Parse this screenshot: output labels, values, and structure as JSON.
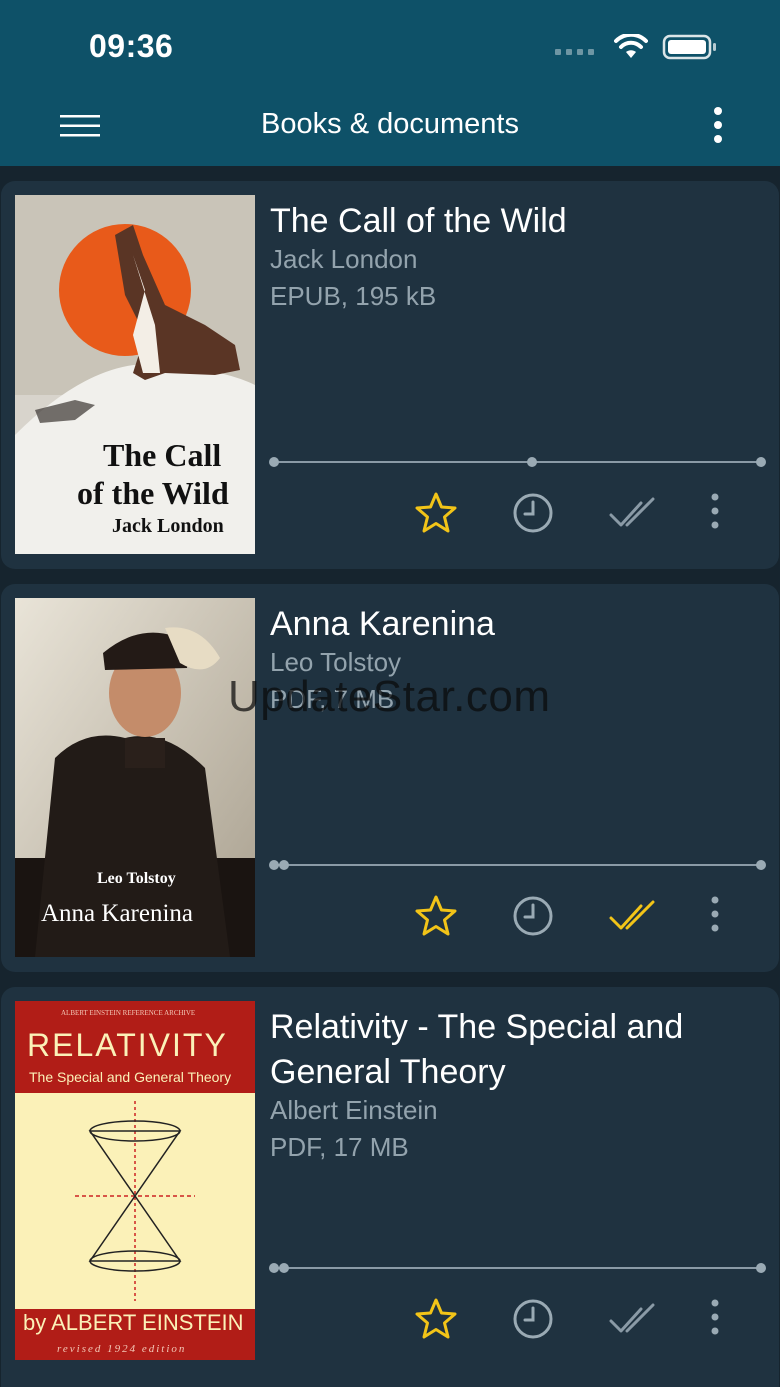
{
  "status": {
    "time": "09:36"
  },
  "header": {
    "title": "Books & documents"
  },
  "books": [
    {
      "title": "The Call of the Wild",
      "author": "Jack London",
      "format": "EPUB, 195 kB",
      "progress": 0.53,
      "favorite": true,
      "finished": false,
      "cover": {
        "line1": "The Call",
        "line2": "of the Wild",
        "line3": "Jack London"
      }
    },
    {
      "title": "Anna Karenina",
      "author": "Leo Tolstoy",
      "format": "PDF, 7 MB",
      "progress": 0.02,
      "favorite": true,
      "finished": true,
      "cover": {
        "line1": "Leo Tolstoy",
        "line2": "Anna Karenina"
      }
    },
    {
      "title": "Relativity - The Special and General Theory",
      "author": "Albert Einstein",
      "format": "PDF, 17 MB",
      "progress": 0.02,
      "favorite": true,
      "finished": false,
      "cover": {
        "top": "ALBERT EINSTEIN REFERENCE ARCHIVE",
        "line1": "RELATIVITY",
        "line2": "The Special and General Theory",
        "line3": "by ALBERT EINSTEIN",
        "line4": "revised 1924 edition"
      }
    }
  ],
  "watermark": "UpdateStar.com",
  "colors": {
    "header": "#0e5168",
    "card": "#1f3240",
    "accent": "#f2c418",
    "muted": "#93a3ad"
  },
  "icons": [
    "menu-icon",
    "more-vert-icon",
    "star-icon",
    "clock-icon",
    "double-check-icon"
  ]
}
